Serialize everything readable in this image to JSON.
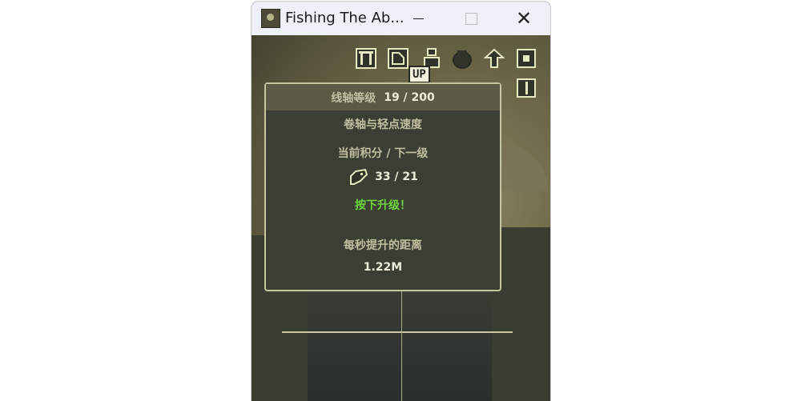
{
  "window": {
    "title": "Fishing The Ab..."
  },
  "toolbar_icons": [
    {
      "name": "pillar-icon"
    },
    {
      "name": "map-icon"
    },
    {
      "name": "rod-icon"
    },
    {
      "name": "pot-icon"
    },
    {
      "name": "arrow-icon"
    },
    {
      "name": "settings-icon"
    },
    {
      "name": "book-icon"
    }
  ],
  "up_badge": "UP",
  "panel": {
    "header_label": "线轴等级",
    "header_value": "19 / 200",
    "subtitle": "卷轴与轻点速度",
    "points_label": "当前积分 / 下一级",
    "points_value": "33 / 21",
    "upgrade_prompt": "按下升级！",
    "distance_label": "每秒提升的距离",
    "distance_value": "1.22M"
  },
  "colors": {
    "panel_bg": "#3b3f33",
    "panel_border": "#c7c6a3",
    "accent_green": "#6dd63e"
  }
}
